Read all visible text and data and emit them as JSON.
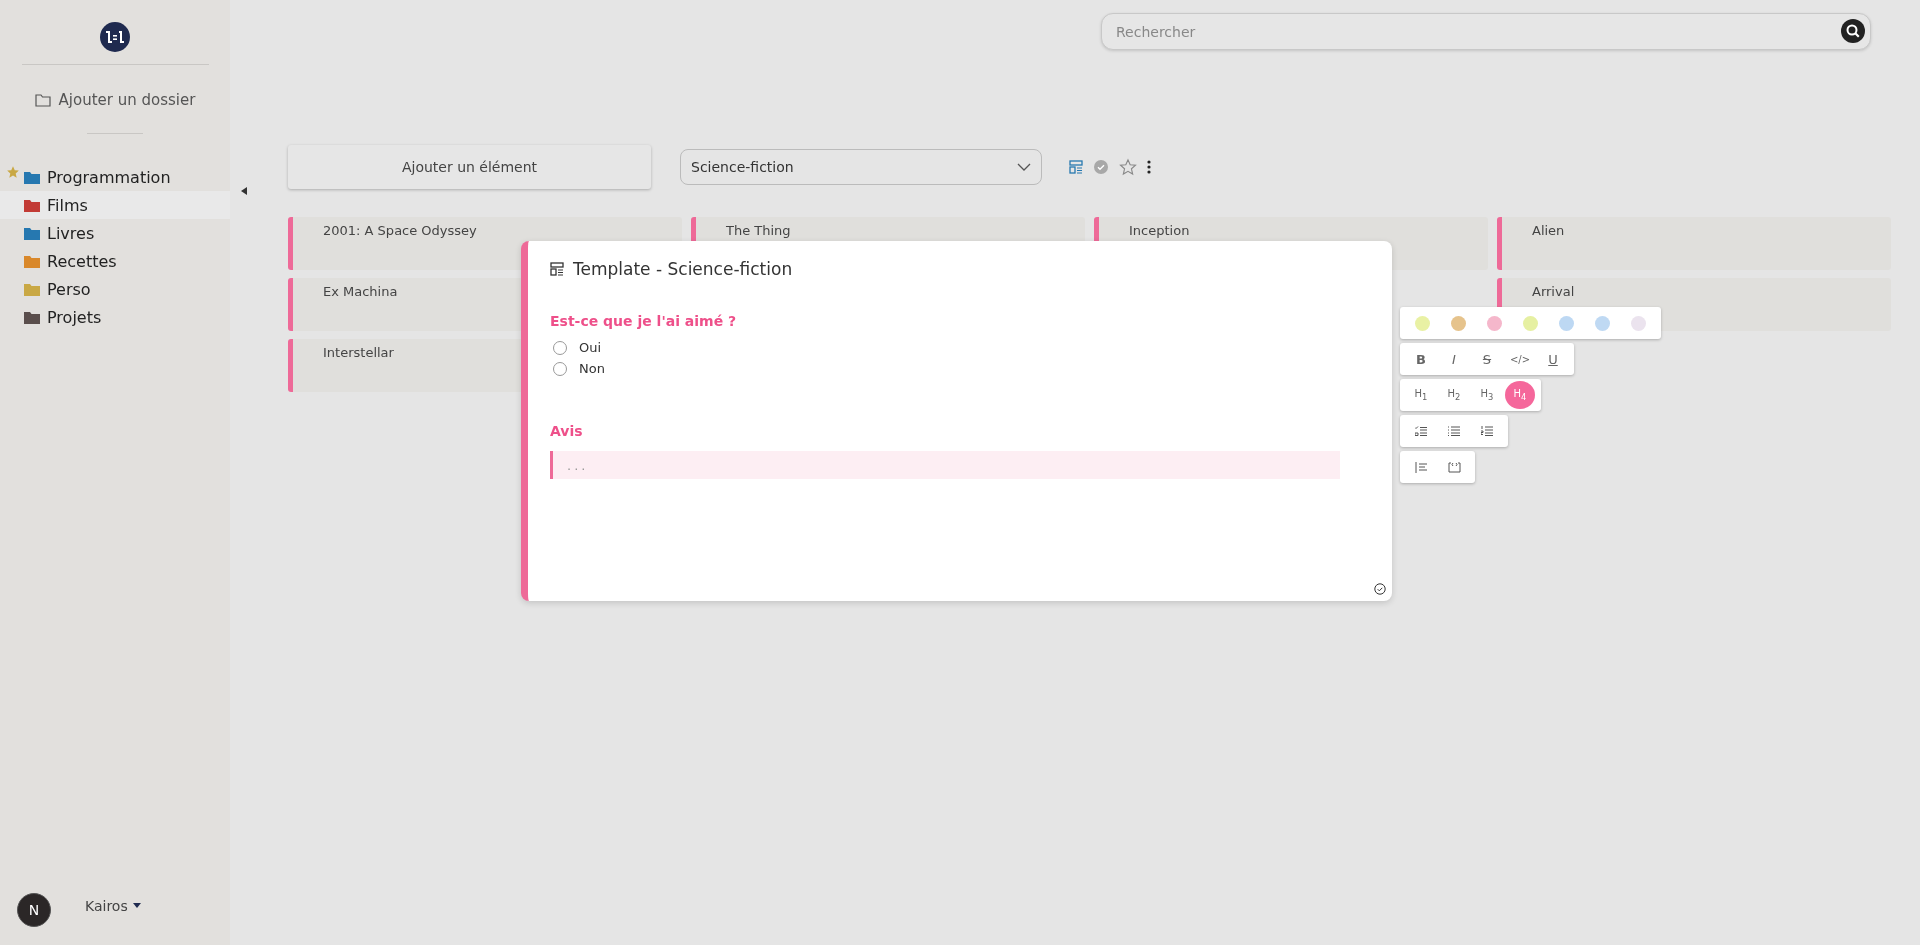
{
  "sidebar": {
    "add_folder": "Ajouter un dossier",
    "folders": [
      {
        "label": "Programmation",
        "color": "#2678b0",
        "selected": false,
        "favorite": true
      },
      {
        "label": "Films",
        "color": "#c23b35",
        "selected": true,
        "favorite": false
      },
      {
        "label": "Livres",
        "color": "#2678b0",
        "selected": false,
        "favorite": false
      },
      {
        "label": "Recettes",
        "color": "#d9882a",
        "selected": false,
        "favorite": false
      },
      {
        "label": "Perso",
        "color": "#c9a844",
        "selected": false,
        "favorite": false
      },
      {
        "label": "Projets",
        "color": "#5a4e4c",
        "selected": false,
        "favorite": false
      }
    ],
    "user": {
      "initial": "N",
      "name": "Kairos"
    }
  },
  "search": {
    "placeholder": "Rechercher"
  },
  "toolbar": {
    "add_button": "Ajouter un élément",
    "template_select": "Science-fiction",
    "done": true,
    "favorite": false
  },
  "columns": [
    {
      "cards": [
        {
          "title": "2001: A Space Odyssey"
        },
        {
          "title": "Ex Machina"
        },
        {
          "title": "Interstellar"
        }
      ]
    },
    {
      "cards": [
        {
          "title": "The Thing"
        }
      ]
    },
    {
      "cards": [
        {
          "title": "Inception"
        }
      ]
    },
    {
      "cards": [
        {
          "title": "Alien"
        },
        {
          "title": "Arrival"
        }
      ]
    }
  ],
  "modal": {
    "title": "Template -  Science-fiction",
    "question": {
      "label": "Est-ce que je l'ai aimé ?",
      "options": [
        {
          "label": "Oui",
          "selected": false
        },
        {
          "label": "Non",
          "selected": false
        }
      ]
    },
    "review": {
      "label": "Avis",
      "placeholder": "..."
    }
  },
  "format_toolbar": {
    "colors": [
      {
        "color": "#e9f1a4"
      },
      {
        "color": "#e6c38c"
      },
      {
        "color": "#f5b7cb"
      },
      {
        "color": "#e6f0a2"
      },
      {
        "color": "#bdd8f3"
      },
      {
        "color": "#bfd9f3"
      },
      {
        "color": "#ebe3ee"
      }
    ],
    "marks": [
      {
        "kind": "bold",
        "label": "B"
      },
      {
        "kind": "italic",
        "label": "I"
      },
      {
        "kind": "strike",
        "label": "S"
      },
      {
        "kind": "code",
        "label": "</>"
      },
      {
        "kind": "underline",
        "label": "U"
      }
    ],
    "headings": [
      {
        "label": "H$_{1}$",
        "selected": false
      },
      {
        "label": "H$_{2}$",
        "selected": false
      },
      {
        "label": "H$_{3}$",
        "selected": false
      },
      {
        "label": "H$_{4}$",
        "selected": true
      }
    ],
    "lists": [
      {
        "kind": "checklist"
      },
      {
        "kind": "bullets"
      },
      {
        "kind": "numbered"
      }
    ],
    "blocks": [
      {
        "kind": "quote"
      },
      {
        "kind": "codeblock"
      }
    ]
  }
}
